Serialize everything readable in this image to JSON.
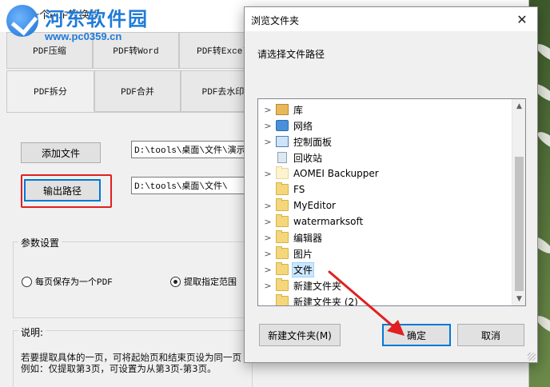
{
  "watermark": {
    "name": "河东软件园",
    "url": "www.pc0359.cn"
  },
  "app": {
    "title": "一个PDF转换器",
    "tabs": [
      {
        "label": "PDF压缩"
      },
      {
        "label": "PDF转Word"
      },
      {
        "label": "PDF转Excel"
      },
      {
        "label": "PDF拆分"
      },
      {
        "label": "PDF合并"
      },
      {
        "label": "PDF去水印"
      }
    ],
    "add_file_button": "添加文件",
    "add_file_path": "D:\\tools\\桌面\\文件\\演示",
    "output_path_button": "输出路径",
    "output_path": "D:\\tools\\桌面\\文件\\",
    "params_title": "参数设置",
    "radio_each_page": "每页保存为一个PDF",
    "radio_range": "提取指定范围",
    "desc_title": "说明:",
    "desc_line1": "若要提取具体的一页，可将起始页和结束页设为同一页",
    "desc_line2": "例如：仅提取第3页，可设置为从第3页-第3页。"
  },
  "dialog": {
    "title": "浏览文件夹",
    "close_glyph": "✕",
    "prompt": "请选择文件路径",
    "tree": [
      {
        "label": "库",
        "icon": "library-icon",
        "expandable": true
      },
      {
        "label": "网络",
        "icon": "network-icon",
        "expandable": true
      },
      {
        "label": "控制面板",
        "icon": "control-panel-icon",
        "expandable": true
      },
      {
        "label": "回收站",
        "icon": "recycle-bin-icon",
        "expandable": false
      },
      {
        "label": "AOMEI Backupper",
        "icon": "folder-icon",
        "expandable": true
      },
      {
        "label": "FS",
        "icon": "folder-icon",
        "expandable": false
      },
      {
        "label": "MyEditor",
        "icon": "folder-icon",
        "expandable": true
      },
      {
        "label": "watermarksoft",
        "icon": "folder-icon",
        "expandable": true
      },
      {
        "label": "编辑器",
        "icon": "folder-icon",
        "expandable": true
      },
      {
        "label": "图片",
        "icon": "folder-icon",
        "expandable": true
      },
      {
        "label": "文件",
        "icon": "folder-icon",
        "expandable": true,
        "selected": true
      },
      {
        "label": "新建文件夹",
        "icon": "folder-icon",
        "expandable": true
      },
      {
        "label": "新建文件夹 (2)",
        "icon": "folder-icon",
        "expandable": false
      }
    ],
    "new_folder_button": "新建文件夹(M)",
    "ok_button": "确定",
    "cancel_button": "取消"
  },
  "colors": {
    "highlight": "#e02020",
    "selection": "#cce8ff",
    "focus": "#0078d7"
  }
}
